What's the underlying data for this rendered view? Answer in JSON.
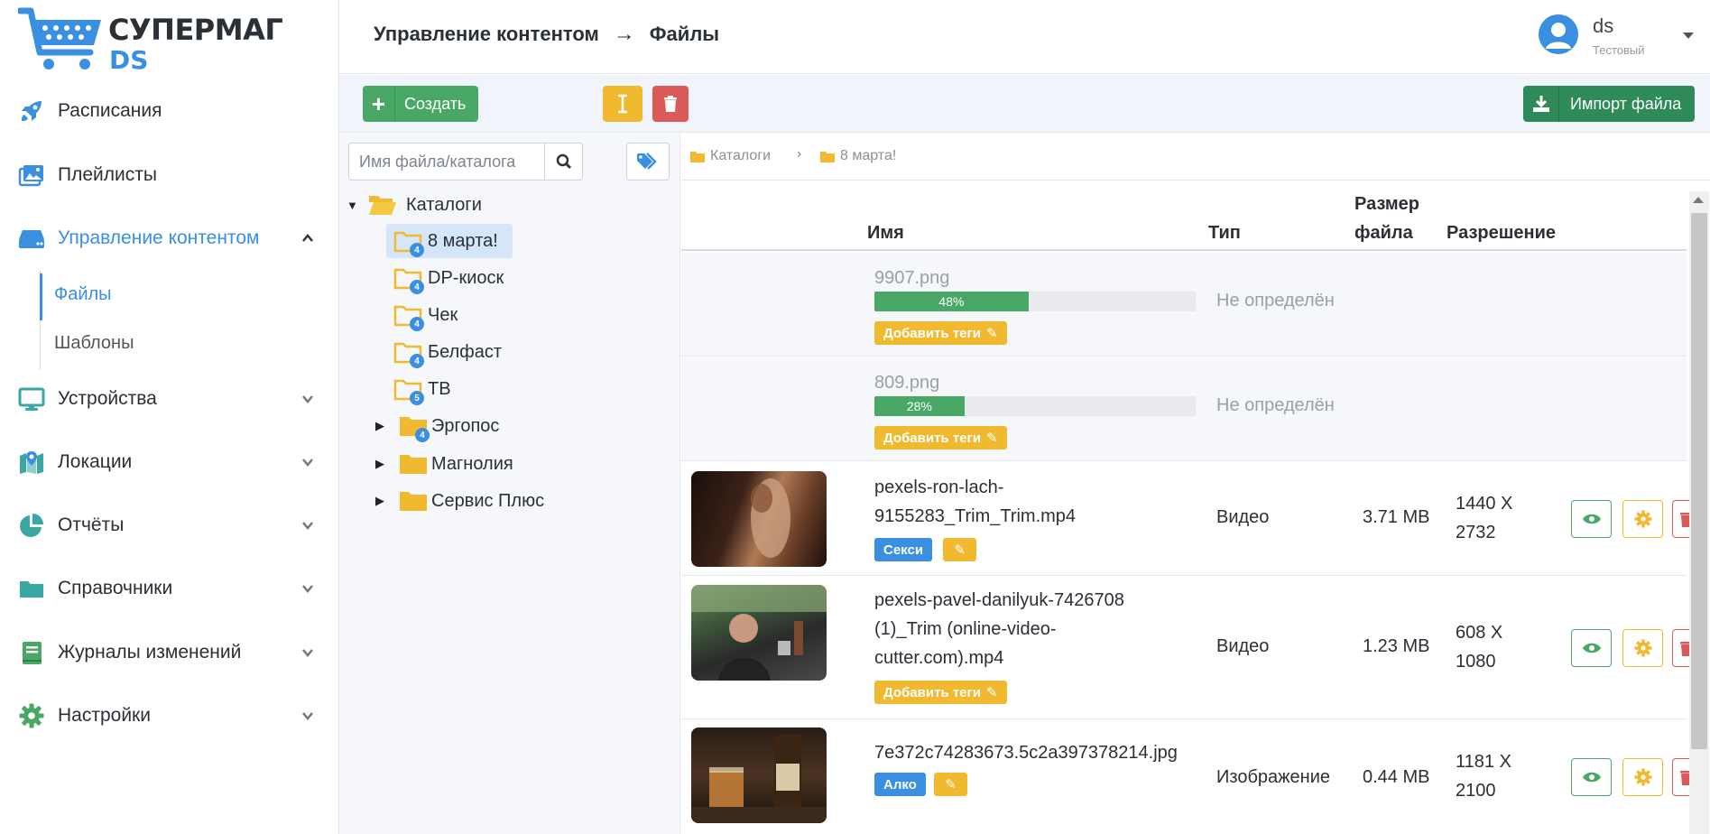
{
  "app": {
    "logo_line1": "СУПЕРМАГ",
    "logo_line2": "DS",
    "colors": {
      "accent": "#3a8fe0",
      "success": "#49a866",
      "warning": "#f0b92f",
      "danger": "#da5a5a",
      "import": "#2f8a59"
    }
  },
  "sidebar": {
    "items": [
      {
        "label": "Расписания",
        "icon": "rocket-icon"
      },
      {
        "label": "Плейлисты",
        "icon": "images-icon"
      },
      {
        "label": "Управление контентом",
        "icon": "drive-icon",
        "expanded": true
      },
      {
        "label": "Устройства",
        "icon": "monitor-icon"
      },
      {
        "label": "Локации",
        "icon": "map-icon"
      },
      {
        "label": "Отчёты",
        "icon": "pie-chart-icon"
      },
      {
        "label": "Справочники",
        "icon": "folder-icon"
      },
      {
        "label": "Журналы изменений",
        "icon": "book-icon"
      },
      {
        "label": "Настройки",
        "icon": "gear-icon"
      }
    ],
    "subitems": [
      {
        "label": "Файлы",
        "active": true
      },
      {
        "label": "Шаблоны",
        "active": false
      }
    ]
  },
  "header": {
    "breadcrumb": [
      "Управление контентом",
      "Файлы"
    ],
    "user": {
      "name": "ds",
      "role": "Тестовый"
    }
  },
  "toolbar": {
    "create_label": "Создать",
    "import_label": "Импорт файла"
  },
  "tree": {
    "search_placeholder": "Имя файла/каталога",
    "root_label": "Каталоги",
    "nodes": [
      {
        "label": "8 марта!",
        "count": "4",
        "selected": true
      },
      {
        "label": "DP-киоск",
        "count": "4"
      },
      {
        "label": "Чек",
        "count": "4"
      },
      {
        "label": "Белфаст",
        "count": "4"
      },
      {
        "label": "ТВ",
        "count": "5"
      },
      {
        "label": "Эргопос",
        "count": "4",
        "collapsed": true
      },
      {
        "label": "Магнолия",
        "collapsed": true
      },
      {
        "label": "Сервис Плюс",
        "collapsed": true
      }
    ]
  },
  "content": {
    "path": [
      "Каталоги",
      "8 марта!"
    ],
    "columns": {
      "name": "Имя",
      "type": "Тип",
      "size_line1": "Размер",
      "size_line2": "файла",
      "resolution": "Разрешение"
    },
    "rows": [
      {
        "name": "9907.png",
        "progress": 48,
        "progress_label": "48%",
        "type": "Не определён",
        "tag": "Добавить теги"
      },
      {
        "name": "809.png",
        "progress": 28,
        "progress_label": "28%",
        "type": "Не определён",
        "tag": "Добавить теги"
      },
      {
        "name_line1": "pexels-ron-lach-",
        "name_line2": "9155283_Trim_Trim.mp4",
        "type": "Видео",
        "size": "3.71 MB",
        "res_line1": "1440 X",
        "res_line2": "2732",
        "tag": "Секси"
      },
      {
        "name_line1": "pexels-pavel-danilyuk-7426708",
        "name_line2": "(1)_Trim (online-video-",
        "name_line3": "cutter.com).mp4",
        "type": "Видео",
        "size": "1.23 MB",
        "res_line1": "608 X",
        "res_line2": "1080",
        "tag": "Добавить теги"
      },
      {
        "name_line1": "7e372c74283673.5c2a397378214.jpg",
        "type": "Изображение",
        "size": "0.44 MB",
        "res_line1": "1181 X",
        "res_line2": "2100",
        "tag": "Алко"
      }
    ]
  }
}
